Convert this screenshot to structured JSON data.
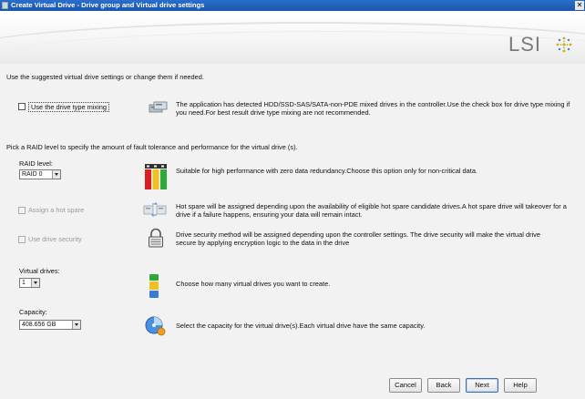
{
  "window": {
    "title": "Create Virtual Drive - Drive group and Virtual drive settings",
    "close_glyph": "✕"
  },
  "banner": {
    "logo_text": "LSI",
    "logo_icon": "lsi-starburst-icon"
  },
  "intro_text": "Use the suggested virtual drive settings or change them if needed.",
  "drive_type_mixing": {
    "label": "Use the drive type mixing",
    "checked": false,
    "description": "The application has detected HDD/SSD-SAS/SATA-non-PDE mixed drives in the controller.Use the check box for drive type mixing if you need.For best result drive type mixing are not recommended."
  },
  "raid_intro": "Pick a RAID level to specify the amount of fault tolerance and performance for the virtual drive (s).",
  "raid_level": {
    "label": "RAID level:",
    "value": "RAID 0",
    "description": "Suitable for high performance with zero data redundancy.Choose this option only for non-critical data."
  },
  "hot_spare": {
    "label": "Assign a hot spare",
    "enabled": false,
    "description": "Hot spare will be assigned depending upon the availability of eligible hot spare candidate drives.A hot spare drive will takeover for a drive if a failure happens, ensuring your data will remain intact."
  },
  "drive_security": {
    "label": "Use drive security",
    "enabled": false,
    "description": "Drive security method will be assigned depending upon the controller settings. The drive security will make the virtual drive secure by applying encryption logic to the data in the drive"
  },
  "virtual_drives": {
    "label": "Virtual drives:",
    "value": "1",
    "description": "Choose how many virtual drives you want to create."
  },
  "capacity": {
    "label": "Capacity:",
    "value": "408.656 GB",
    "description": "Select the capacity for the virtual drive(s).Each virtual drive have the same capacity."
  },
  "buttons": {
    "cancel": "Cancel",
    "back": "Back",
    "next": "Next",
    "help": "Help"
  },
  "colors": {
    "title_bar": "#1a56ac",
    "raid_bar_red": "#d92020",
    "raid_bar_yellow": "#f0c020",
    "raid_bar_green": "#2ea83a"
  }
}
